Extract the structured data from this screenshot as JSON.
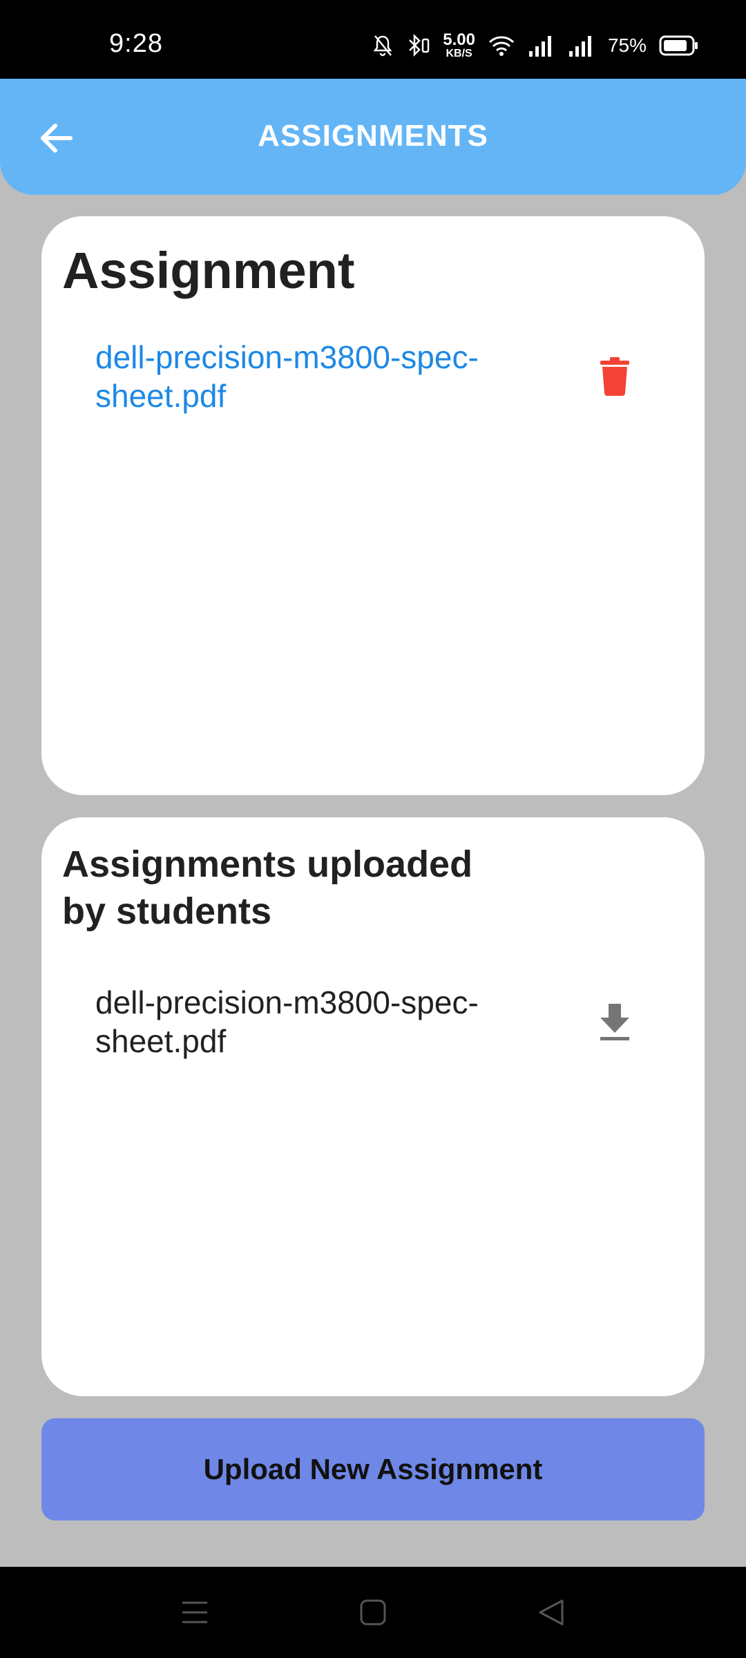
{
  "status_bar": {
    "time": "9:28",
    "net_speed_value": "5.00",
    "net_speed_unit": "KB/S",
    "battery_percent": "75%",
    "icons": [
      "mute-bell-icon",
      "bluetooth-icon",
      "wifi-icon",
      "signal-icon",
      "signal-icon",
      "battery-icon"
    ]
  },
  "app_bar": {
    "title": "ASSIGNMENTS",
    "back_icon": "arrow-left-icon",
    "color": "#64b5f6"
  },
  "assignment_card": {
    "title": "Assignment",
    "files": [
      {
        "name": "dell-precision-m3800-spec-sheet.pdf",
        "action_icon": "trash-icon",
        "action_color": "#f44336"
      }
    ]
  },
  "students_card": {
    "title": "Assignments uploaded by students",
    "files": [
      {
        "name": "dell-precision-m3800-spec-sheet.pdf",
        "action_icon": "download-icon"
      }
    ]
  },
  "upload_button": {
    "label": "Upload New Assignment",
    "color": "#6f87e6"
  },
  "nav_bar": {
    "icons": [
      "menu-icon",
      "home-icon",
      "back-triangle-icon"
    ]
  }
}
